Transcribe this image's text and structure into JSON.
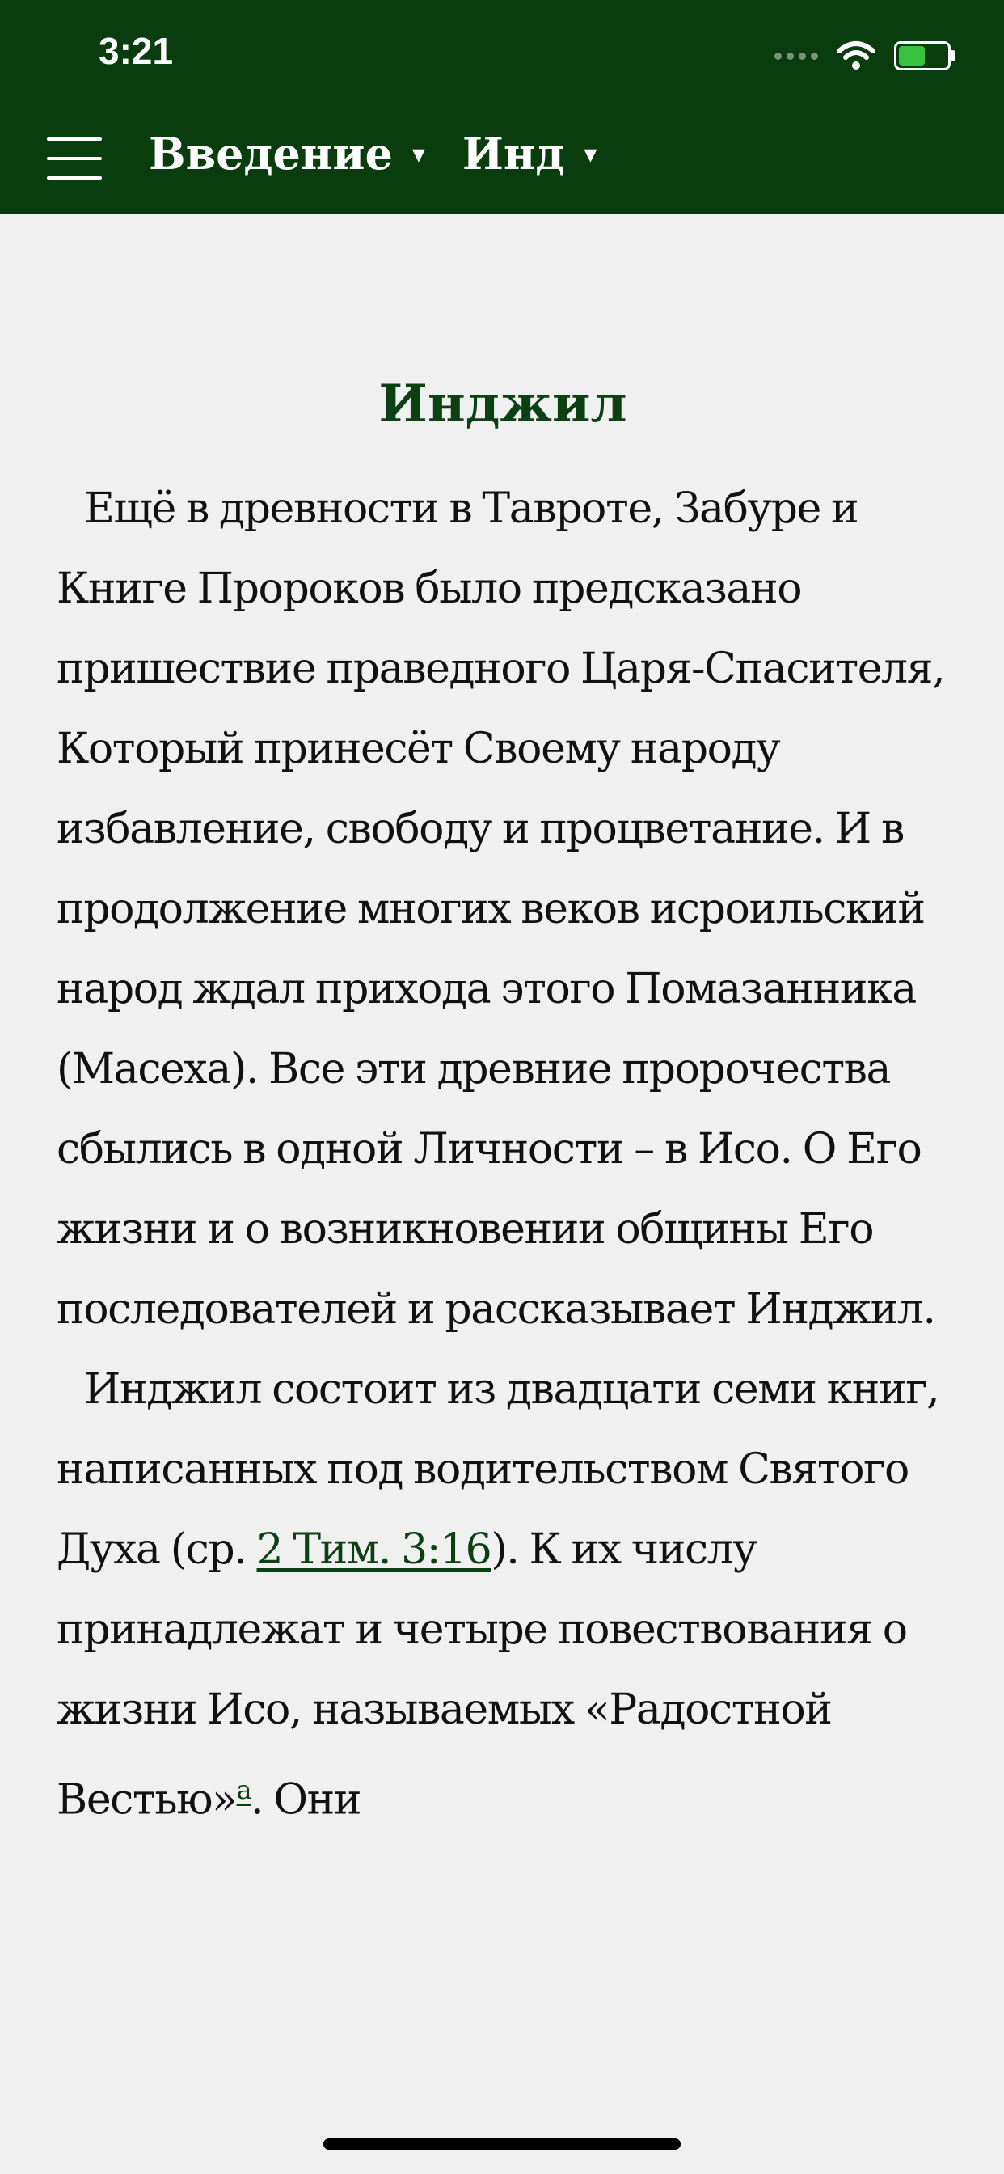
{
  "status_bar": {
    "time": "3:21"
  },
  "header": {
    "book_selector": {
      "label": "Введение",
      "caret": "▾"
    },
    "chapter_selector": {
      "label": "Инд",
      "caret": "▾"
    }
  },
  "article": {
    "title": "Инджил",
    "paragraph1": "Ещё в древности в Тавроте, Забуре и Книге Пророков было предсказано пришествие праведного Царя-Спасителя, Который принесёт Своему народу избавление, свободу и процветание. И в продолжение многих веков исроильский народ ждал прихода этого Помазанника (Масеха). Все эти древние пророчества сбылись в одной Личности – в Исо. О Его жизни и о возникновении общины Его последователей и рассказывает Инджил.",
    "paragraph2": {
      "text_before_link": "Инджил состоит из двадцати семи книг, написанных под водительством Святого Духа (ср. ",
      "link": "2 Тим. 3:16",
      "text_after_link": "). К их числу принадлежат и четыре повествования о жизни Исо, называемых «Радостной Вестью»",
      "footnote": "а",
      "text_end": ". Они"
    }
  },
  "icons": {
    "menu": "hamburger-menu-icon",
    "signal": "cellular-signal-icon",
    "wifi": "wifi-icon",
    "battery": "battery-charging-icon"
  },
  "colors": {
    "header_bg": "#0a3d0d",
    "accent": "#0b4012",
    "page_bg": "#f0f0f0",
    "battery_fill": "#37c341"
  }
}
